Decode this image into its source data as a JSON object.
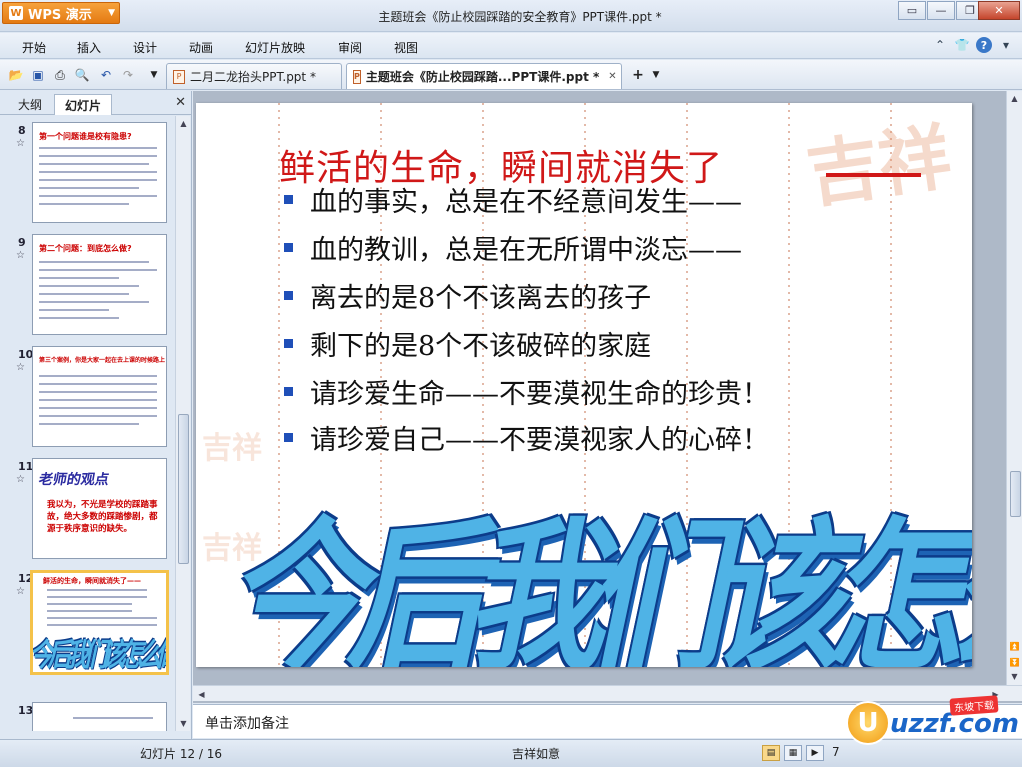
{
  "app": {
    "name": "WPS 演示",
    "logo_letter": "W",
    "window_title": "主题班会《防止校园踩踏的安全教育》PPT课件.ppt *"
  },
  "menu": [
    "开始",
    "插入",
    "设计",
    "动画",
    "幻灯片放映",
    "审阅",
    "视图"
  ],
  "tabs": [
    {
      "label": "二月二龙抬头PPT.ppt *"
    },
    {
      "label": "主题班会《防止校园踩踏...PPT课件.ppt *"
    }
  ],
  "sidebar": {
    "tab_outline": "大纲",
    "tab_slides": "幻灯片",
    "slides": [
      {
        "num": "8",
        "title": "第一个问题谁是校有隐患?"
      },
      {
        "num": "9",
        "title": "第二个问题：到底怎么做?"
      },
      {
        "num": "10",
        "title": "第三个案例，你是大家一起在去上课的时候路上"
      },
      {
        "num": "11",
        "title": "老师的观点",
        "body": "我以为，不光是学校的踩踏事故，绝大多数的踩踏惨剧，都源于秩序意识的缺失。"
      },
      {
        "num": "12",
        "title": "鲜活的生命，瞬间就消失了——",
        "art": "今后我们该怎么做?"
      },
      {
        "num": "13",
        "title": ""
      }
    ]
  },
  "slide": {
    "title": "鲜活的生命，瞬间就消失了",
    "bullets": [
      "血的事实，总是在不经意间发生——",
      "血的教训，总是在无所谓中淡忘——",
      "离去的是8个不该离去的孩子",
      "剩下的是8个不该破碎的家庭",
      "请珍爱生命——不要漠视生命的珍贵！",
      "请珍爱自己——不要漠视家人的心碎！"
    ],
    "wordart": "今后我们该怎么做?",
    "deco_char": "吉祥"
  },
  "notes": {
    "placeholder": "单击添加备注"
  },
  "status": {
    "slide_counter": "幻灯片 12 / 16",
    "theme": "吉祥如意",
    "zoom": "7"
  },
  "watermark": {
    "brand": "uzzf.com",
    "badge": "东坡下载",
    "letter": "U"
  }
}
